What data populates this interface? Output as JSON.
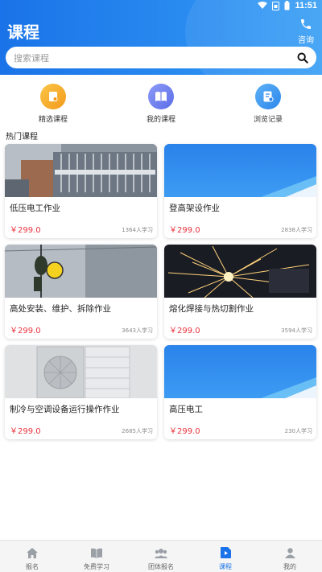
{
  "status": {
    "time": "11:51"
  },
  "header": {
    "title": "课程",
    "consult_label": "咨询"
  },
  "search": {
    "placeholder": "搜索课程"
  },
  "quick_nav": [
    {
      "label": "精选课程",
      "icon": "featured-course-icon",
      "color": "#f6a623"
    },
    {
      "label": "我的课程",
      "icon": "book-icon",
      "color": "#6c7ff2"
    },
    {
      "label": "浏览记录",
      "icon": "history-icon",
      "color": "#3d9bf2"
    }
  ],
  "section": {
    "hot_courses": "热门课程"
  },
  "courses": [
    {
      "name": "低压电工作业",
      "price": "￥299.0",
      "learners": "1364人学习"
    },
    {
      "name": "登高架设作业",
      "price": "￥299.0",
      "learners": "2838人学习"
    },
    {
      "name": "高处安装、维护、拆除作业",
      "price": "￥299.0",
      "learners": "3643人学习"
    },
    {
      "name": "熔化焊接与热切割作业",
      "price": "￥299.0",
      "learners": "3594人学习"
    },
    {
      "name": "制冷与空调设备运行操作作业",
      "price": "￥299.0",
      "learners": "2685人学习"
    },
    {
      "name": "高压电工",
      "price": "￥299.0",
      "learners": "230人学习"
    }
  ],
  "bottom_nav": [
    {
      "label": "报名",
      "icon": "home-icon",
      "active": false
    },
    {
      "label": "免费学习",
      "icon": "book-open-icon",
      "active": false
    },
    {
      "label": "团体报名",
      "icon": "group-icon",
      "active": false
    },
    {
      "label": "课程",
      "icon": "course-icon",
      "active": true
    },
    {
      "label": "我的",
      "icon": "user-icon",
      "active": false
    }
  ],
  "colors": {
    "primary": "#1a73e8",
    "price": "#e8323c"
  }
}
